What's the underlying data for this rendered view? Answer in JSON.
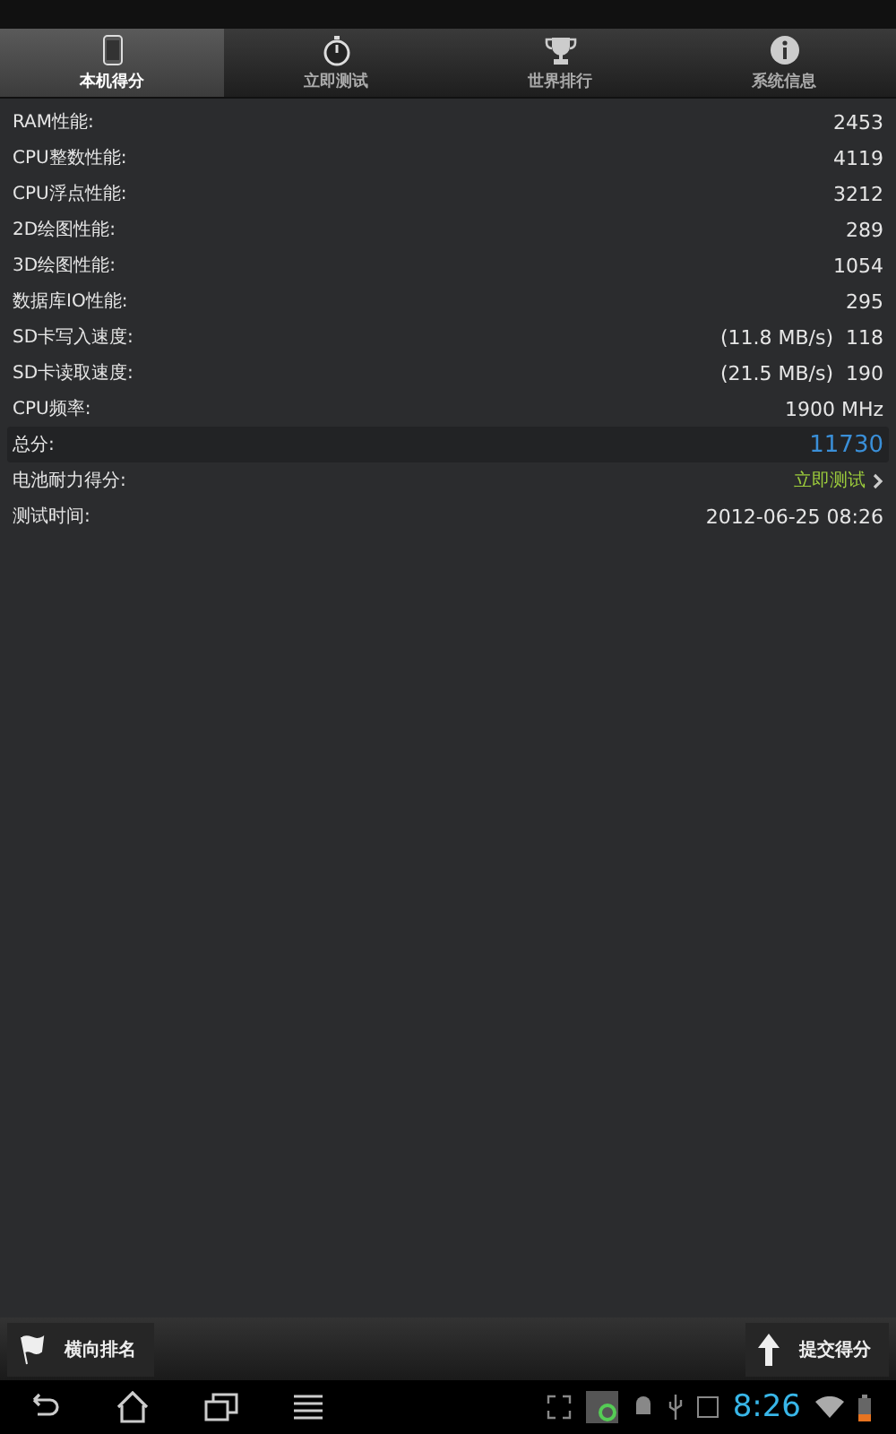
{
  "tabs": [
    {
      "label": "本机得分",
      "kind": "phone",
      "selected": true
    },
    {
      "label": "立即测试",
      "kind": "stopwatch",
      "selected": false
    },
    {
      "label": "世界排行",
      "kind": "trophy",
      "selected": false
    },
    {
      "label": "系统信息",
      "kind": "info",
      "selected": false
    }
  ],
  "rows": [
    {
      "kind": "value",
      "label": "RAM性能:",
      "value": "2453"
    },
    {
      "kind": "value",
      "label": "CPU整数性能:",
      "value": "4119"
    },
    {
      "kind": "value",
      "label": "CPU浮点性能:",
      "value": "3212"
    },
    {
      "kind": "value",
      "label": "2D绘图性能:",
      "value": "289"
    },
    {
      "kind": "value",
      "label": "3D绘图性能:",
      "value": "1054"
    },
    {
      "kind": "value",
      "label": "数据库IO性能:",
      "value": "295"
    },
    {
      "kind": "value",
      "label": "SD卡写入速度:",
      "value": "(11.8 MB/s)  118"
    },
    {
      "kind": "value",
      "label": "SD卡读取速度:",
      "value": "(21.5 MB/s)  190"
    },
    {
      "kind": "value",
      "label": "CPU频率:",
      "value": "1900 MHz"
    },
    {
      "kind": "total",
      "label": "总分:",
      "value": "11730"
    },
    {
      "kind": "link",
      "label": "电池耐力得分:",
      "value": "立即测试"
    },
    {
      "kind": "value",
      "label": "测试时间:",
      "value": "2012-06-25 08:26"
    }
  ],
  "actions": {
    "left": "横向排名",
    "right": "提交得分"
  },
  "status_bar": {
    "time": "8:26"
  }
}
